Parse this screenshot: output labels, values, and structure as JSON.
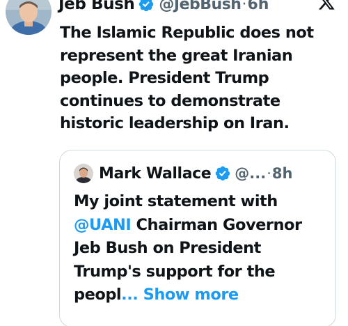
{
  "tweet": {
    "display_name": "Jeb Bush",
    "handle": "@JebBush",
    "separator": "·",
    "time": "6h",
    "text": "The Islamic Republic does not represent the great Iranian people. President Trump continues to demonstrate historic leadership on Iran.",
    "verified_icon": "verified-badge-icon",
    "logo_icon": "x-logo-icon"
  },
  "quote": {
    "display_name": "Mark Wallace",
    "handle": "@...",
    "separator": "·",
    "time": "8h",
    "text_before": "My joint statement with ",
    "mention": "@UANI",
    "text_after": " Chairman Governor Jeb Bush on President Trump's support for the peopl",
    "show_more": "... Show more",
    "verified_icon": "verified-badge-icon"
  },
  "colors": {
    "text": "#0f1419",
    "secondary": "#536471",
    "link": "#1d9bf0",
    "border": "#cfd9de",
    "verified": "#1d9bf0"
  }
}
